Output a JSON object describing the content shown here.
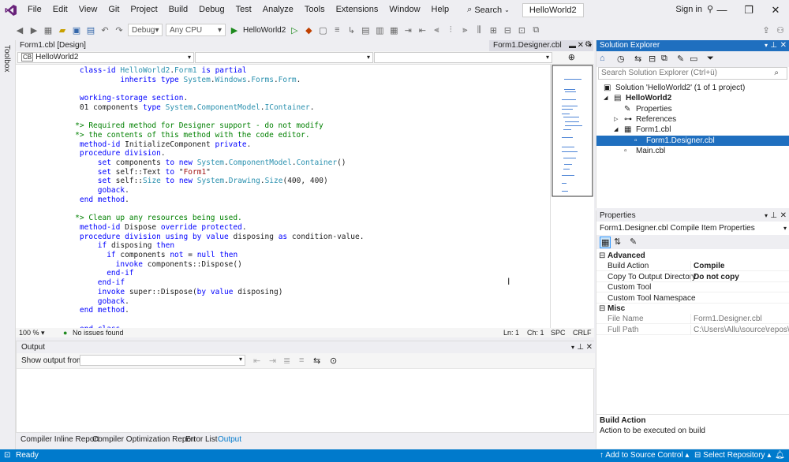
{
  "menubar": {
    "items": [
      "File",
      "Edit",
      "View",
      "Git",
      "Project",
      "Build",
      "Debug",
      "Test",
      "Analyze",
      "Tools",
      "Extensions",
      "Window",
      "Help"
    ],
    "search_label": "Search",
    "solution_title": "HelloWorld2",
    "sign_in": "Sign in"
  },
  "toolbar": {
    "config": "Debug",
    "platform": "Any CPU",
    "start_target": "HelloWorld2"
  },
  "toolbox_label": "Toolbox",
  "doc_tabs": {
    "left_tab": "Form1.cbl [Design]",
    "active_tab": "Form1.Designer.cbl"
  },
  "navbar": {
    "project_dropdown": "HelloWorld2"
  },
  "code": [
    {
      "t": "    class-id HelloWorld2.Form1 is partial",
      "c": "k"
    },
    {
      "t": "             inherits type System.Windows.Forms.Form.",
      "c": "k"
    },
    {
      "t": "",
      "c": ""
    },
    {
      "t": "    working-storage section.",
      "c": "k"
    },
    {
      "t": "    01 components type System.ComponentModel.IContainer.",
      "c": "k"
    },
    {
      "t": "",
      "c": ""
    },
    {
      "t": "   *> Required method for Designer support - do not modify",
      "c": "c"
    },
    {
      "t": "   *> the contents of this method with the code editor.",
      "c": "c"
    },
    {
      "t": "    method-id InitializeComponent private.",
      "c": "k"
    },
    {
      "t": "    procedure division.",
      "c": "k"
    },
    {
      "t": "        set components to new System.ComponentModel.Container()",
      "c": "k"
    },
    {
      "t": "        set self::Text to \"Form1\"",
      "c": "k"
    },
    {
      "t": "        set self::Size to new System.Drawing.Size(400, 400)",
      "c": "k"
    },
    {
      "t": "        goback.",
      "c": "k"
    },
    {
      "t": "    end method.",
      "c": "k"
    },
    {
      "t": "",
      "c": ""
    },
    {
      "t": "   *> Clean up any resources being used.",
      "c": "c"
    },
    {
      "t": "    method-id Dispose override protected.",
      "c": "k"
    },
    {
      "t": "    procedure division using by value disposing as condition-value.",
      "c": "k"
    },
    {
      "t": "        if disposing then",
      "c": "k"
    },
    {
      "t": "          if components not = null then",
      "c": "k"
    },
    {
      "t": "            invoke components::Dispose()",
      "c": "k"
    },
    {
      "t": "          end-if",
      "c": "k"
    },
    {
      "t": "        end-if",
      "c": "k"
    },
    {
      "t": "        invoke super::Dispose(by value disposing)",
      "c": "k"
    },
    {
      "t": "        goback.",
      "c": "k"
    },
    {
      "t": "    end method.",
      "c": "k"
    },
    {
      "t": "",
      "c": ""
    },
    {
      "t": "    end class.",
      "c": "k"
    }
  ],
  "editor_status": {
    "zoom": "100 %",
    "issues": "No issues found",
    "line": "Ln: 1",
    "col": "Ch: 1",
    "spc": "SPC",
    "eol": "CRLF"
  },
  "output": {
    "title": "Output",
    "show_from_label": "Show output from:"
  },
  "bottom_tabs": [
    "Compiler Inline Report",
    "Compiler Optimization Report",
    "Error List",
    "Output"
  ],
  "solution_explorer": {
    "title": "Solution Explorer",
    "search_placeholder": "Search Solution Explorer (Ctrl+ü)",
    "tree": [
      {
        "label": "Solution 'HelloWorld2' (1 of 1 project)",
        "indent": 0,
        "bold": false,
        "sel": false
      },
      {
        "label": "HelloWorld2",
        "indent": 1,
        "bold": true,
        "sel": false
      },
      {
        "label": "Properties",
        "indent": 2,
        "bold": false,
        "sel": false
      },
      {
        "label": "References",
        "indent": 2,
        "bold": false,
        "sel": false
      },
      {
        "label": "Form1.cbl",
        "indent": 2,
        "bold": false,
        "sel": false
      },
      {
        "label": "Form1.Designer.cbl",
        "indent": 3,
        "bold": false,
        "sel": true
      },
      {
        "label": "Main.cbl",
        "indent": 2,
        "bold": false,
        "sel": false
      }
    ]
  },
  "properties": {
    "title": "Properties",
    "object": "Form1.Designer.cbl  Compile Item Properties",
    "sections": [
      {
        "name": "Advanced",
        "rows": [
          {
            "k": "Build Action",
            "v": "Compile",
            "b": true
          },
          {
            "k": "Copy To Output Directory",
            "v": "Do not copy",
            "b": true
          },
          {
            "k": "Custom Tool",
            "v": "",
            "b": false
          },
          {
            "k": "Custom Tool Namespace",
            "v": "",
            "b": false
          }
        ]
      },
      {
        "name": "Misc",
        "rows": [
          {
            "k": "File Name",
            "v": "Form1.Designer.cbl",
            "b": false
          },
          {
            "k": "Full Path",
            "v": "C:\\Users\\Allu\\source\\repos\\Hello",
            "b": false
          }
        ]
      }
    ],
    "desc_title": "Build Action",
    "desc_text": "Action to be executed on build"
  },
  "statusbar": {
    "ready": "Ready",
    "add_source": "Add to Source Control",
    "select_repo": "Select Repository"
  },
  "colors": {
    "accent": "#007acc",
    "selection": "#1f6fbf"
  }
}
